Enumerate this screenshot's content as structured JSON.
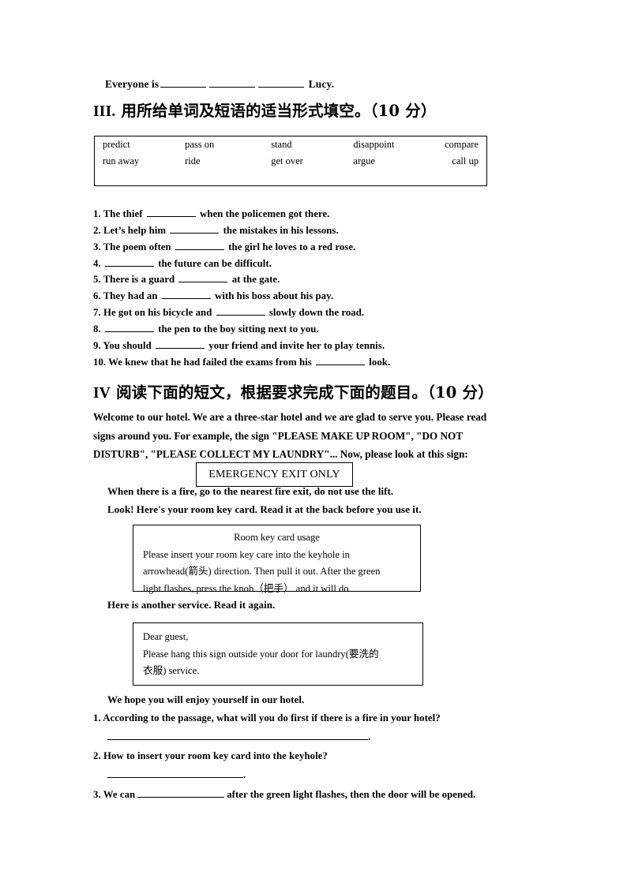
{
  "document": {
    "carryover_question": {
      "prefix": "Everyone is",
      "blank_widths": [
        58,
        58,
        58
      ],
      "suffix": "Lucy."
    },
    "sections": [
      {
        "id": "section-iii",
        "roman": "III",
        "heading": "III. 用所给单词及短语的适当形式填空。（10 分）",
        "heading_roman_part": "III.",
        "heading_cjk_part": " 用所给单词及短语的适当形式填空。（10 分）",
        "word_bank": {
          "rows": [
            [
              "predict",
              "pass on",
              "stand",
              "disappoint",
              "compare"
            ],
            [
              "run away",
              "ride",
              "get over",
              "argue",
              "call up"
            ]
          ]
        },
        "questions": [
          {
            "number": "1.",
            "before": "The thief",
            "blank": 62,
            "after": "when the policemen got there."
          },
          {
            "number": "2.",
            "before": "Let’s help him",
            "blank": 62,
            "after": "the mistakes in his lessons."
          },
          {
            "number": "3.",
            "before": "The poem often",
            "blank": 62,
            "after": "the girl he loves to a red rose."
          },
          {
            "number": "4.",
            "before": "",
            "blank": 62,
            "after": "the future can be difficult."
          },
          {
            "number": "5.",
            "before": "There is a guard",
            "blank": 62,
            "after": "at the gate."
          },
          {
            "number": "6.",
            "before": "They had an",
            "blank": 62,
            "after": "with his boss about his pay."
          },
          {
            "number": "7.",
            "before": "He got on his bicycle and",
            "blank": 62,
            "after": "slowly down the road."
          },
          {
            "number": "8.",
            "before": "",
            "blank": 62,
            "after": "the pen to the boy sitting next to you."
          },
          {
            "number": "9.",
            "before": "You should",
            "blank": 62,
            "after": "your friend and invite her to play tennis."
          },
          {
            "number": "10.",
            "before": "We knew that he had failed the exams from his",
            "blank": 62,
            "after": "look."
          }
        ]
      },
      {
        "id": "section-iv",
        "roman": "IV",
        "heading": "IV 阅读下面的短文，根据要求完成下面的题目。（10 分）",
        "heading_roman_part": "IV",
        "heading_cjk_part": " 阅读下面的短文，根据要求完成下面的题目。（10 分）",
        "passage": {
          "line1": "Welcome to our hotel. We are a three-star hotel and we are glad to serve you. Please read",
          "line2": "signs around you. For example, the sign \"PLEASE MAKE UP ROOM\", \"DO NOT",
          "line3": "DISTURB\", \"PLEASE COLLECT MY LAUNDRY\"... Now, please look at this sign:"
        },
        "emergency_sign": {
          "text": "EMERGENCY EXIT ONLY"
        },
        "narratives": {
          "fire": "When there is a fire, go to the nearest fire exit, do not use the lift.",
          "look": "Look! Here's your room key card. Read it at the back before you use it.",
          "another": "Here is another service. Read it again.",
          "hope": "We hope you will enjoy yourself in our hotel."
        },
        "keycard_box": {
          "title": "Room key card usage",
          "line1": "Please insert your room key care into the keyhole in",
          "line2": "arrowhead(箭头) direction. Then pull it out. After the green",
          "line3": "light flashes, press the knob（把手）  and it will do."
        },
        "laundry_box": {
          "salutation": "Dear guest,",
          "line1": "Please hang this sign outside your door for laundry(要洗的",
          "line2": "衣服) service."
        },
        "reading_questions": [
          {
            "number": "1.",
            "text": "According to the passage, what will you do first if there is a fire in your hotel?",
            "answer_blank_width": 330,
            "answer_terminator": "."
          },
          {
            "number": "2.",
            "text": "How to insert your room key card into the keyhole?",
            "answer_blank_width": 172,
            "answer_terminator": "."
          },
          {
            "number": "3.",
            "before": "We can",
            "blank": 110,
            "after": "after the green light flashes, then the door will be opened."
          }
        ]
      }
    ]
  },
  "colors": {
    "ink": "#000000",
    "paper": "#ffffff",
    "rule": "#000000"
  }
}
